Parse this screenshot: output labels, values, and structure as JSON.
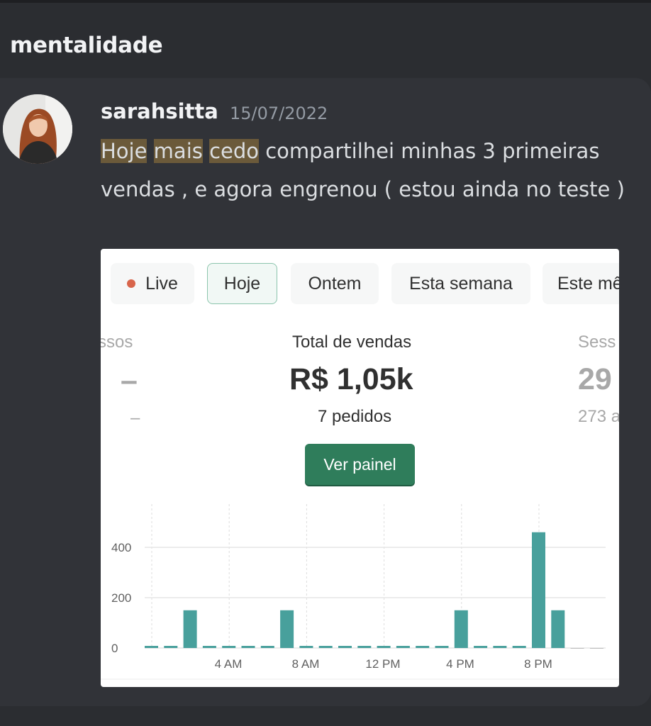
{
  "channel": {
    "title": "mentalidade"
  },
  "message": {
    "username": "sarahsitta",
    "timestamp": "15/07/2022",
    "text_highlight_1": "Hoje",
    "text_highlight_2": "mais",
    "text_highlight_3": "cedo",
    "text_rest": " compartilhei minhas 3 primeiras vendas , e agora engrenou ( estou ainda no teste )"
  },
  "dashboard": {
    "filters": [
      "Live",
      "Hoje",
      "Ontem",
      "Esta semana",
      "Este mê"
    ],
    "active_filter": "Hoje",
    "live_dot_color": "#d8654b",
    "left_metric": {
      "label": "ssos",
      "value": "–",
      "sub": "–"
    },
    "center_metric": {
      "label": "Total de vendas",
      "value": "R$ 1,05k",
      "sub": "7 pedidos"
    },
    "right_metric": {
      "label": "Sess",
      "value": "29",
      "sub": "273 a"
    },
    "button_label": "Ver painel",
    "accent_color": "#2f7d5b"
  },
  "chart_data": {
    "type": "bar",
    "x": [
      "12 AM",
      "1 AM",
      "2 AM",
      "3 AM",
      "4 AM",
      "5 AM",
      "6 AM",
      "7 AM",
      "8 AM",
      "9 AM",
      "10 AM",
      "11 AM",
      "12 PM",
      "1 PM",
      "2 PM",
      "3 PM",
      "4 PM",
      "5 PM",
      "6 PM",
      "7 PM",
      "8 PM",
      "9 PM",
      "10 PM",
      "11 PM"
    ],
    "values": [
      0,
      0,
      150,
      0,
      0,
      0,
      0,
      150,
      0,
      0,
      0,
      0,
      0,
      0,
      0,
      0,
      150,
      0,
      0,
      0,
      460,
      150,
      0,
      0
    ],
    "x_tick_labels": [
      "4 AM",
      "8 AM",
      "12 PM",
      "4 PM",
      "8 PM"
    ],
    "y_tick_labels": [
      "0",
      "200",
      "400"
    ],
    "ylim": [
      0,
      500
    ],
    "bar_color": "#48a09c",
    "grid": true
  }
}
